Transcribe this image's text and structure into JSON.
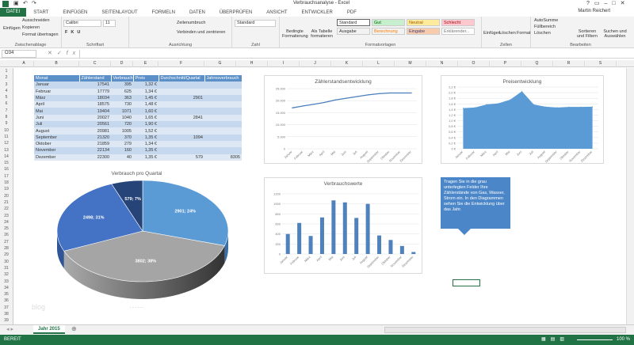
{
  "window": {
    "title": "Verbrauchsanalyse - Excel",
    "user": "Martin Reichert"
  },
  "tabs": [
    "DATEI",
    "START",
    "EINFÜGEN",
    "SEITENLAYOUT",
    "FORMELN",
    "DATEN",
    "ÜBERPRÜFEN",
    "ANSICHT",
    "ENTWICKLER",
    "PDF"
  ],
  "ribbon": {
    "clipboard": {
      "label": "Zwischenablage",
      "paste": "Einfügen",
      "cut": "Ausschneiden",
      "copy": "Kopieren",
      "format": "Format übertragen"
    },
    "font": {
      "label": "Schriftart",
      "name": "Calibri",
      "size": "11"
    },
    "alignment": {
      "label": "Ausrichtung",
      "wrap": "Zeilenumbruch",
      "merge": "Verbinden und zentrieren"
    },
    "number": {
      "label": "Zahl",
      "format": "Standard"
    },
    "styles": {
      "label": "Formatvorlagen",
      "cond": "Bedingte Formatierung",
      "table": "Als Tabelle formatieren",
      "items": [
        "Standard",
        "Gut",
        "Neutral",
        "Schlecht",
        "Ausgabe",
        "Berechnung",
        "Eingabe",
        "Erklärender..."
      ]
    },
    "cells": {
      "label": "Zellen",
      "insert": "Einfügen",
      "delete": "Löschen",
      "format": "Format"
    },
    "editing": {
      "label": "Bearbeiten",
      "autosum": "AutoSumme",
      "fill": "Füllbereich",
      "clear": "Löschen",
      "sort": "Sortieren und Filtern",
      "find": "Suchen und Auswählen"
    }
  },
  "formula_bar": {
    "name_box": "O34",
    "value": ""
  },
  "columns": [
    "A",
    "B",
    "C",
    "D",
    "E",
    "F",
    "G",
    "H",
    "I",
    "J",
    "K",
    "L",
    "M",
    "N",
    "O",
    "P",
    "Q",
    "R",
    "S"
  ],
  "rows": [
    "1",
    "2",
    "3",
    "4",
    "5",
    "6",
    "7",
    "8",
    "9",
    "10",
    "11",
    "12",
    "13",
    "14",
    "15",
    "16",
    "17",
    "18",
    "19",
    "20",
    "21",
    "22",
    "23",
    "24",
    "25",
    "26",
    "27",
    "28",
    "29",
    "30",
    "31",
    "32",
    "33",
    "34",
    "35",
    "36",
    "37",
    "38",
    "39"
  ],
  "table": {
    "headers": [
      "Monat",
      "Zählerstand",
      "Verbrauch (kWh)",
      "Preis",
      "Durchschnitt/Quartal",
      "Jahresverbrauch"
    ],
    "rows": [
      [
        "Januar",
        "17541",
        "395",
        "1,32 €",
        "",
        ""
      ],
      [
        "Februar",
        "17779",
        "625",
        "1,34 €",
        "",
        ""
      ],
      [
        "März",
        "18034",
        "363",
        "1,45 €",
        "2901",
        ""
      ],
      [
        "April",
        "18575",
        "730",
        "1,48 €",
        "",
        ""
      ],
      [
        "Mai",
        "19404",
        "1071",
        "1,60 €",
        "",
        ""
      ],
      [
        "Juni",
        "20027",
        "1040",
        "1,65 €",
        "2841",
        ""
      ],
      [
        "Juli",
        "20561",
        "720",
        "1,90 €",
        "",
        ""
      ],
      [
        "August",
        "20981",
        "1005",
        "1,52 €",
        "",
        ""
      ],
      [
        "September",
        "21320",
        "370",
        "1,35 €",
        "1094",
        ""
      ],
      [
        "Oktober",
        "21859",
        "279",
        "1,34 €",
        "",
        ""
      ],
      [
        "November",
        "22134",
        "160",
        "1,35 €",
        "",
        ""
      ],
      [
        "Dezember",
        "22300",
        "40",
        "1,35 €",
        "579",
        "8305"
      ]
    ]
  },
  "chart_data": [
    {
      "type": "line",
      "title": "Zählerstandsentwicklung",
      "categories": [
        "Januar",
        "Februar",
        "März",
        "April",
        "Mai",
        "Juni",
        "Juli",
        "August",
        "September",
        "Oktober",
        "November",
        "Dezember"
      ],
      "values": [
        17000,
        17800,
        18500,
        19300,
        20300,
        21000,
        21700,
        22400,
        22900,
        23200,
        23200,
        23200
      ],
      "ylim": [
        0,
        25000
      ],
      "yticks": [
        "0",
        "5.000",
        "10.000",
        "15.000",
        "20.000",
        "25.000"
      ]
    },
    {
      "type": "area",
      "title": "Preisentwicklung",
      "categories": [
        "Januar",
        "Februar",
        "März",
        "April",
        "Mai",
        "Juni",
        "Juli",
        "August",
        "September",
        "Oktober",
        "November",
        "Dezember"
      ],
      "values": [
        1.45,
        1.47,
        1.58,
        1.62,
        1.75,
        2.05,
        1.58,
        1.5,
        1.47,
        1.49,
        1.49,
        1.5
      ],
      "ylim": [
        0,
        2.2
      ],
      "yticks": [
        "0 €",
        "0,2 €",
        "0,4 €",
        "0,6 €",
        "0,8 €",
        "1,0 €",
        "1,2 €",
        "1,4 €",
        "1,6 €",
        "1,8 €",
        "2,0 €",
        "2,2 €"
      ]
    },
    {
      "type": "pie",
      "title": "Verbrauch pro Quartal",
      "values": [
        2901,
        3802,
        2498,
        579
      ],
      "labels": [
        "2901; 24%",
        "3802; 38%",
        "2498; 31%",
        "579; 7%"
      ],
      "colors": [
        "#5b9bd5",
        "#a5a5a5",
        "#4472c4",
        "#264478"
      ],
      "legend": "· · · · · ·"
    },
    {
      "type": "bar",
      "title": "Verbrauchswerte",
      "categories": [
        "Januar",
        "Februar",
        "März",
        "April",
        "Mai",
        "Juni",
        "Juli",
        "August",
        "September",
        "Oktober",
        "November",
        "Dezember"
      ],
      "values": [
        400,
        620,
        360,
        730,
        1070,
        1030,
        720,
        1000,
        370,
        280,
        160,
        40
      ],
      "ylim": [
        0,
        1200
      ],
      "yticks": [
        "0",
        "200",
        "400",
        "600",
        "800",
        "1000",
        "1200"
      ]
    }
  ],
  "callout": "Tragen Sie in die grau unterlegten Felder Ihre Zählerstände von Gas, Wasser, Strom ein. In den Diagrammen sehen Sie die Entwicklung über das Jahr.",
  "watermark": "blog",
  "sheet_tab": "Jahr 2015",
  "status": {
    "ready": "BEREIT",
    "zoom": "100 %"
  }
}
